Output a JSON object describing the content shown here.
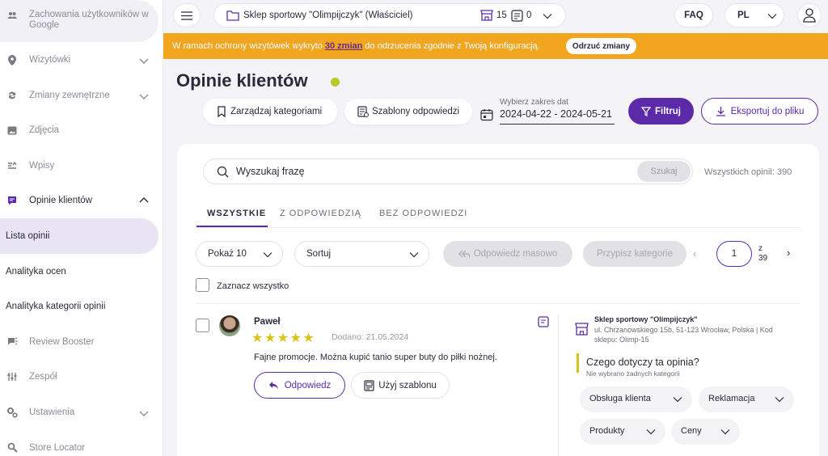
{
  "sidebar": {
    "items": [
      {
        "label": "Zachowania użytkowników w Google",
        "icon": "users-icon"
      },
      {
        "label": "Wizytówki",
        "icon": "location-pin-icon"
      },
      {
        "label": "Zmiany zewnętrzne",
        "icon": "sync-icon"
      },
      {
        "label": "Zdjęcia",
        "icon": "image-icon"
      },
      {
        "label": "Wpisy",
        "icon": "posts-icon"
      },
      {
        "label": "Opinie klientów",
        "icon": "review-icon"
      },
      {
        "label": "Lista opinii"
      },
      {
        "label": "Analityka ocen"
      },
      {
        "label": "Analityka kategorii opinii"
      },
      {
        "label": "Review Booster",
        "icon": "booster-icon"
      },
      {
        "label": "Zespół",
        "icon": "team-icon"
      },
      {
        "label": "Ustawienia",
        "icon": "settings-icon"
      },
      {
        "label": "Store Locator",
        "icon": "store-locator-icon"
      }
    ]
  },
  "topbar": {
    "business": "Sklep sportowy \"Olimpijczyk\" (Właściciel)",
    "locations_count": "15",
    "alerts_count": "0",
    "faq": "FAQ",
    "lang": "PL"
  },
  "banner": {
    "text_before": "W ramach ochrony wizytówek wykryto ",
    "link": "30 zmian",
    "text_after": " do odrzucenia zgodnie z Twoją konfiguracją.",
    "button": "Odrzuć zmiany",
    "color": "#f2a51f"
  },
  "header": {
    "title": "Opinie klientów",
    "manage_categories": "Zarządzaj kategoriami",
    "reply_templates": "Szablony odpowiedzi",
    "date_label": "Wybierz zakres dat",
    "date_range": "2024-04-22 - 2024-05-21",
    "filter": "Filtruj",
    "export": "Eksportuj do pliku"
  },
  "search": {
    "placeholder": "Wyszukaj frazę",
    "button": "Szukaj",
    "total": "Wszystkich opinii: 390"
  },
  "tabs": [
    {
      "label": "WSZYSTKIE",
      "active": true
    },
    {
      "label": "Z ODPOWIEDZIĄ",
      "active": false
    },
    {
      "label": "BEZ ODPOWIEDZI",
      "active": false
    }
  ],
  "controls": {
    "show": "Pokaż 10",
    "sort": "Sortuj",
    "bulk_reply": "Odpowiedz masowo",
    "assign_category": "Przypisz kategorie",
    "page": "1",
    "of_label": "z",
    "total_pages": "39",
    "select_all": "Zaznacz wszystko"
  },
  "review": {
    "author": "Paweł",
    "rating": 5,
    "stars": "★★★★★",
    "date": "Dodano: 21.05.2024",
    "text": "Fajne promocje. Można kupić tanio super buty do piłki nożnej.",
    "reply": "Odpowiedz",
    "use_template": "Użyj szablonu",
    "location_name": "Sklep sportowy \"Olimpijczyk\"",
    "location_address": "ul. Chrzanowskiego 15b, 51-123 Wrocław, Polska | Kod sklepu: Olimp-15",
    "question": "Czego dotyczy ta opinia?",
    "no_categories": "Nie wybrano żadnych kategorii",
    "categories": [
      "Obsługa klienta",
      "Reklamacja",
      "Produkty",
      "Ceny"
    ]
  },
  "colors": {
    "accent": "#5a2aa8",
    "star": "#d6c316"
  }
}
